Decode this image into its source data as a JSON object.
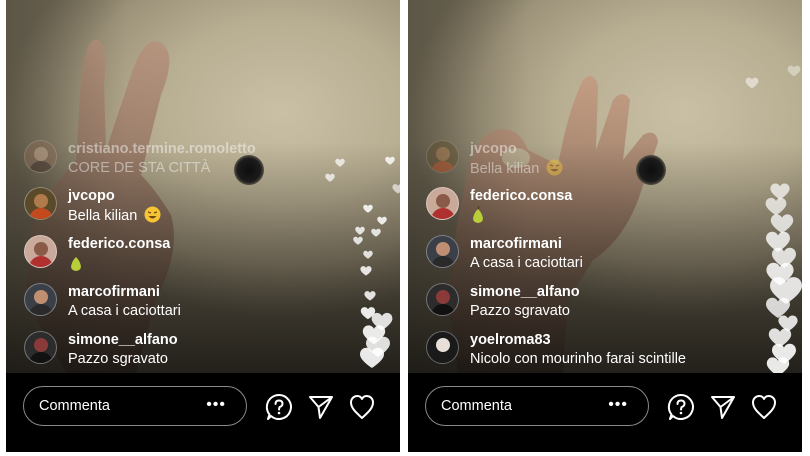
{
  "left_panel": {
    "comments": [
      {
        "username": "cristiano.termine.romoletto",
        "message": "CORE DE STA CITTÀ",
        "emoji": ""
      },
      {
        "username": "jvcopo",
        "message": "Bella kilian",
        "emoji": "laughing-face"
      },
      {
        "username": "federico.consa",
        "message": "",
        "emoji": "pear"
      },
      {
        "username": "marcofirmani",
        "message": "A casa i caciottari",
        "emoji": ""
      },
      {
        "username": "simone__alfano",
        "message": "Pazzo sgravato",
        "emoji": ""
      }
    ],
    "comment_placeholder": "Commenta",
    "more_label": "•••"
  },
  "right_panel": {
    "comments": [
      {
        "username": "jvcopo",
        "message": "Bella kilian",
        "emoji": "laughing-face"
      },
      {
        "username": "federico.consa",
        "message": "",
        "emoji": "pear"
      },
      {
        "username": "marcofirmani",
        "message": "A casa i caciottari",
        "emoji": ""
      },
      {
        "username": "simone__alfano",
        "message": "Pazzo sgravato",
        "emoji": ""
      },
      {
        "username": "yoelroma83",
        "message": "Nicolo con mourinho farai scintille",
        "emoji": ""
      }
    ],
    "comment_placeholder": "Commenta",
    "more_label": "•••"
  },
  "icons": [
    "question-icon",
    "send-icon",
    "heart-icon"
  ],
  "colors": {
    "background": "#000000",
    "text": "#ffffff",
    "pill_border": "#8a8a8a"
  }
}
